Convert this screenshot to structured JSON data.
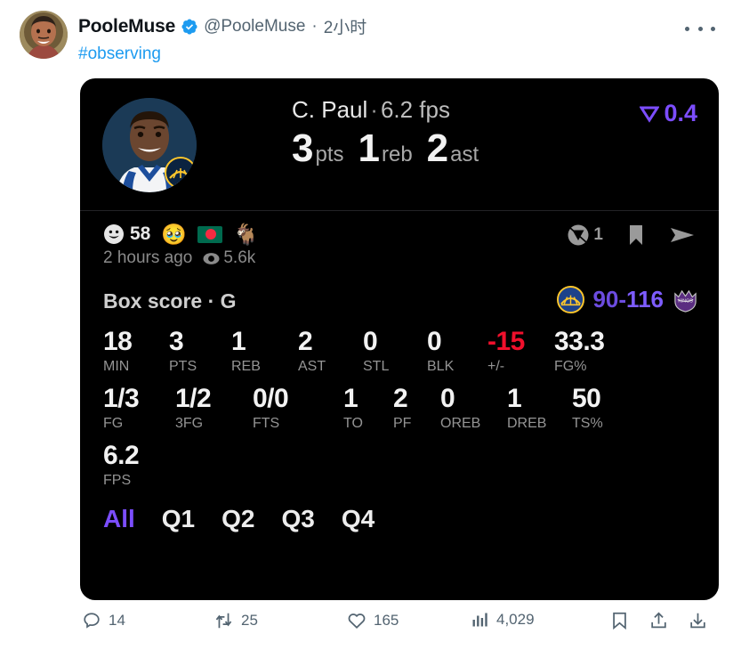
{
  "tweet": {
    "display_name": "PooleMuse",
    "verified": true,
    "handle": "@PooleMuse",
    "separator": "·",
    "timestamp": "2小时",
    "hashtag": "#observing",
    "more_icon": "more-horizontal-icon"
  },
  "card": {
    "player": {
      "name": "C. Paul",
      "separator": "·",
      "fps_label": "6.2 fps",
      "photo_alt": "player-headshot",
      "team_badge": "warriors-logo"
    },
    "headline_stats": [
      {
        "value": "3",
        "label": "pts"
      },
      {
        "value": "1",
        "label": "reb"
      },
      {
        "value": "2",
        "label": "ast"
      }
    ],
    "trend": {
      "icon": "trend-down-icon",
      "value": "0.4",
      "color": "#7c4dff"
    },
    "reactions": {
      "smiley_icon": "smiley-face-icon",
      "smiley_count": "58",
      "emojis": [
        "🥹",
        "bangladesh-flag",
        "🐐"
      ],
      "right_actions": [
        {
          "icon": "vote-badge-icon",
          "count": "1"
        },
        {
          "icon": "bookmark-icon",
          "count": ""
        },
        {
          "icon": "send-icon",
          "count": ""
        }
      ]
    },
    "meta": {
      "time_ago": "2 hours ago",
      "views_icon": "eye-icon",
      "views": "5.6k"
    },
    "box_score": {
      "title": "Box score · G",
      "away_logo": "warriors-logo",
      "home_logo": "kings-logo",
      "away_score": "90",
      "dash": "-",
      "home_score": "116"
    },
    "stats_row1": [
      {
        "value": "18",
        "label": "MIN",
        "negative": false
      },
      {
        "value": "3",
        "label": "PTS",
        "negative": false
      },
      {
        "value": "1",
        "label": "REB",
        "negative": false
      },
      {
        "value": "2",
        "label": "AST",
        "negative": false
      },
      {
        "value": "0",
        "label": "STL",
        "negative": false
      },
      {
        "value": "0",
        "label": "BLK",
        "negative": false
      },
      {
        "value": "-15",
        "label": "+/-",
        "negative": true
      },
      {
        "value": "33.3",
        "label": "FG%",
        "negative": false
      }
    ],
    "stats_row2": [
      {
        "value": "1/3",
        "label": "FG",
        "negative": false
      },
      {
        "value": "1/2",
        "label": "3FG",
        "negative": false
      },
      {
        "value": "0/0",
        "label": "FTS",
        "negative": false
      },
      {
        "value": "1",
        "label": "TO",
        "negative": false
      },
      {
        "value": "2",
        "label": "PF",
        "negative": false
      },
      {
        "value": "0",
        "label": "OREB",
        "negative": false
      },
      {
        "value": "1",
        "label": "DREB",
        "negative": false
      },
      {
        "value": "50",
        "label": "TS%",
        "negative": false
      }
    ],
    "stats_row3": [
      {
        "value": "6.2",
        "label": "FPS",
        "negative": false
      }
    ],
    "tabs": [
      {
        "label": "All",
        "active": true
      },
      {
        "label": "Q1",
        "active": false
      },
      {
        "label": "Q2",
        "active": false
      },
      {
        "label": "Q3",
        "active": false
      },
      {
        "label": "Q4",
        "active": false
      }
    ]
  },
  "actions": [
    {
      "icon": "reply-icon",
      "count": "14"
    },
    {
      "icon": "retweet-icon",
      "count": "25"
    },
    {
      "icon": "like-icon",
      "count": "165"
    },
    {
      "icon": "views-icon",
      "count": "4,029"
    },
    {
      "icon": "bookmark-icon",
      "count": ""
    },
    {
      "icon": "share-icon",
      "count": ""
    },
    {
      "icon": "download-icon",
      "count": ""
    }
  ],
  "colors": {
    "accent_purple": "#7c4dff",
    "link_blue": "#1d9bf0",
    "negative_red": "#f0102c",
    "card_bg": "#000000",
    "muted": "#536471"
  }
}
